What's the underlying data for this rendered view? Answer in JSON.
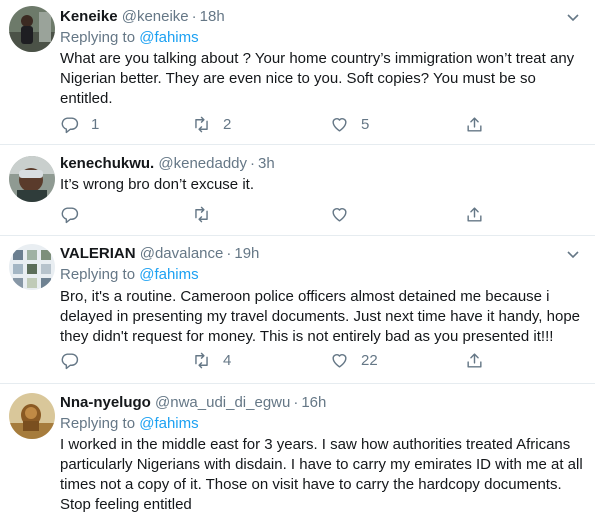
{
  "tweets": [
    {
      "name": "Keneike",
      "handle": "@keneike",
      "time": "18h",
      "replying_prefix": "Replying to ",
      "replying_to": "@fahims",
      "text": "What are you talking about ? Your home country’s immigration won’t treat any Nigerian better. They are even nice to you. Soft copies? You must be so entitled.",
      "replies": "1",
      "retweets": "2",
      "likes": "5"
    },
    {
      "name": "kenechukwu.",
      "handle": "@kenedaddy",
      "time": "3h",
      "text": "It’s wrong bro don’t excuse it."
    },
    {
      "name": "VALERIAN",
      "handle": "@davalance",
      "time": "19h",
      "replying_prefix": "Replying to ",
      "replying_to": "@fahims",
      "text": "Bro, it's a routine. Cameroon police officers almost detained me because i delayed in presenting my travel documents. Just next time have it handy, hope they didn't request for money. This is not entirely bad as you presented it!!!",
      "retweets": "4",
      "likes": "22"
    },
    {
      "name": "Nna-nyelugo",
      "handle": "@nwa_udi_di_egwu",
      "time": "16h",
      "replying_prefix": "Replying to ",
      "replying_to": "@fahims",
      "text": "I worked in the middle east for 3 years. I saw how authorities treated Africans particularly Nigerians with disdain. I have to carry my emirates ID with me at all times not a copy of it. Those on visit have to carry the hardcopy documents. Stop feeling entitled"
    }
  ],
  "separator": "·",
  "colors": {
    "link": "#1da1f2",
    "muted": "#657786",
    "text": "#14171a",
    "border": "#e6ecf0"
  },
  "icons": [
    "reply-icon",
    "retweet-icon",
    "like-icon",
    "share-icon",
    "chevron-down-icon"
  ]
}
